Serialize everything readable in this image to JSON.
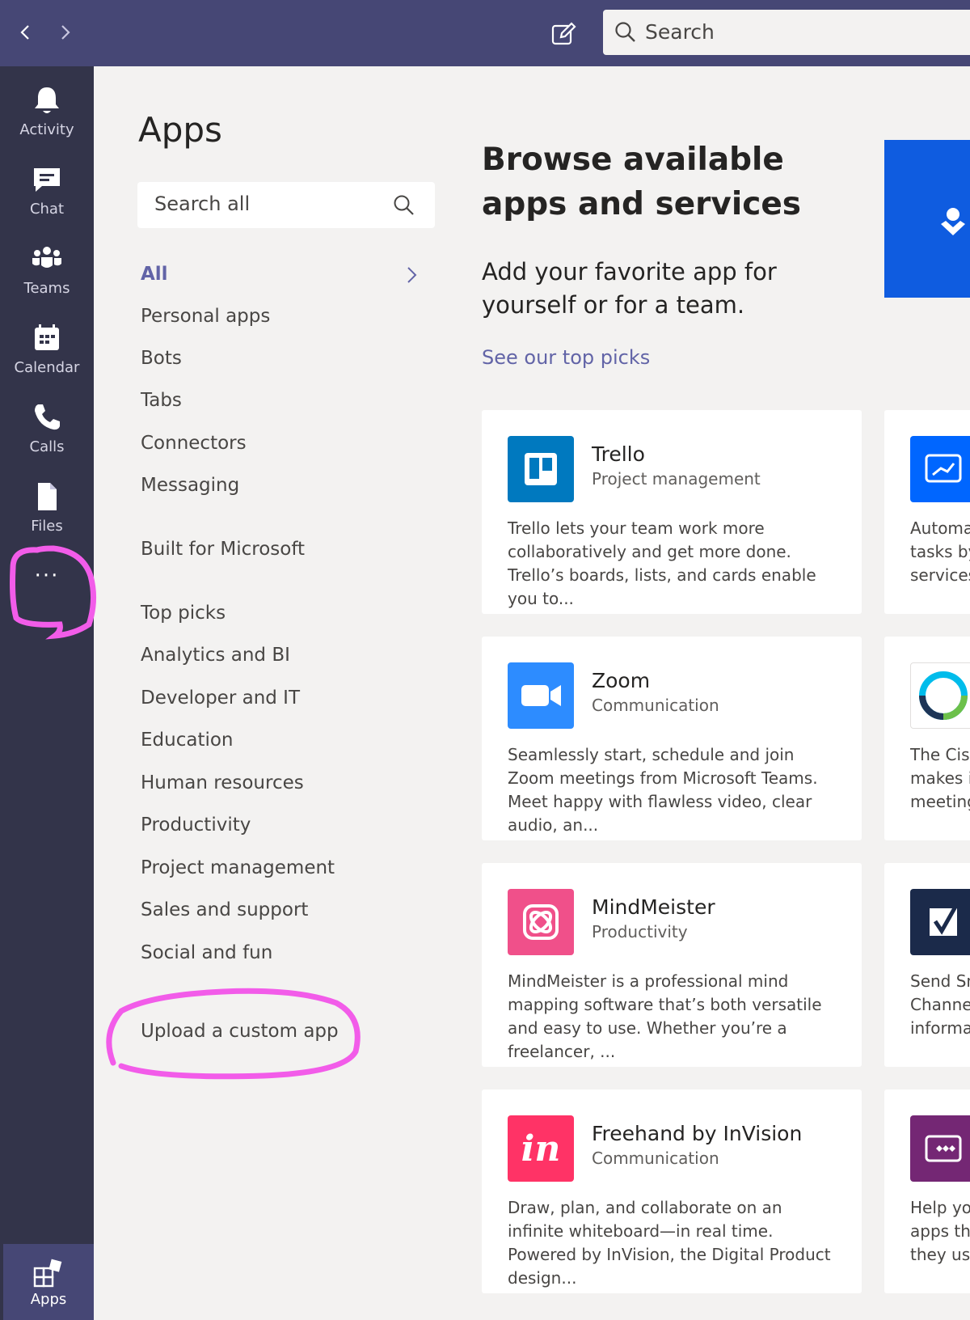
{
  "topbar": {
    "back_icon": "chevron-left-icon",
    "forward_icon": "chevron-right-icon",
    "compose_icon": "new-chat-icon",
    "search_placeholder": "Search"
  },
  "rail": {
    "items": [
      {
        "label": "Activity",
        "icon": "bell-icon"
      },
      {
        "label": "Chat",
        "icon": "chat-icon"
      },
      {
        "label": "Teams",
        "icon": "teams-icon"
      },
      {
        "label": "Calendar",
        "icon": "calendar-icon"
      },
      {
        "label": "Calls",
        "icon": "phone-icon"
      },
      {
        "label": "Files",
        "icon": "file-icon"
      }
    ],
    "more": "···",
    "apps_label": "Apps"
  },
  "left": {
    "title": "Apps",
    "search_placeholder": "Search all",
    "categories_group1": [
      "All",
      "Personal apps",
      "Bots",
      "Tabs",
      "Connectors",
      "Messaging"
    ],
    "built_for": "Built for Microsoft",
    "categories_group2": [
      "Top picks",
      "Analytics and BI",
      "Developer and IT",
      "Education",
      "Human resources",
      "Productivity",
      "Project management",
      "Sales and support",
      "Social and fun"
    ],
    "upload": "Upload a custom app"
  },
  "hero": {
    "title": "Browse available apps and services",
    "subtitle": "Add your favorite app for yourself or for a team.",
    "link": "See our top picks"
  },
  "cards": [
    {
      "name": "Trello",
      "category": "Project management",
      "description": "Trello lets your team work more collaboratively and get more done. Trello’s boards, lists, and cards enable you to...",
      "color": "#0079bf"
    },
    {
      "name": "Zoom",
      "category": "Communication",
      "description": "Seamlessly start, schedule and join Zoom meetings from Microsoft Teams. Meet happy with flawless video, clear audio, an...",
      "color": "#2d8cff"
    },
    {
      "name": "MindMeister",
      "category": "Productivity",
      "description": "MindMeister is a professional mind mapping software that’s both versatile and easy to use. Whether you’re a freelancer, ...",
      "color": "#f0508a"
    },
    {
      "name": "Freehand by InVision",
      "category": "Communication",
      "description": "Draw, plan, and collaborate on an infinite whiteboard—in real time. Powered by InVision, the Digital Product design...",
      "color": "#ff3366"
    }
  ],
  "cards_partial": [
    {
      "lines": [
        "Automa",
        "tasks by",
        "services"
      ],
      "color": "#0066ff"
    },
    {
      "lines": [
        "The Cisc",
        "makes it",
        "meeting"
      ],
      "color": "#ffffff"
    },
    {
      "lines": [
        "Send Sm",
        "Channel",
        "informat"
      ],
      "color": "#1b2a4a"
    },
    {
      "lines": [
        "Help you",
        "apps tha",
        "they use"
      ],
      "color": "#742774"
    }
  ],
  "colors": {
    "accent": "#6264a7",
    "topbar": "#464775",
    "rail": "#33344a",
    "annotation": "#f25ce9"
  }
}
